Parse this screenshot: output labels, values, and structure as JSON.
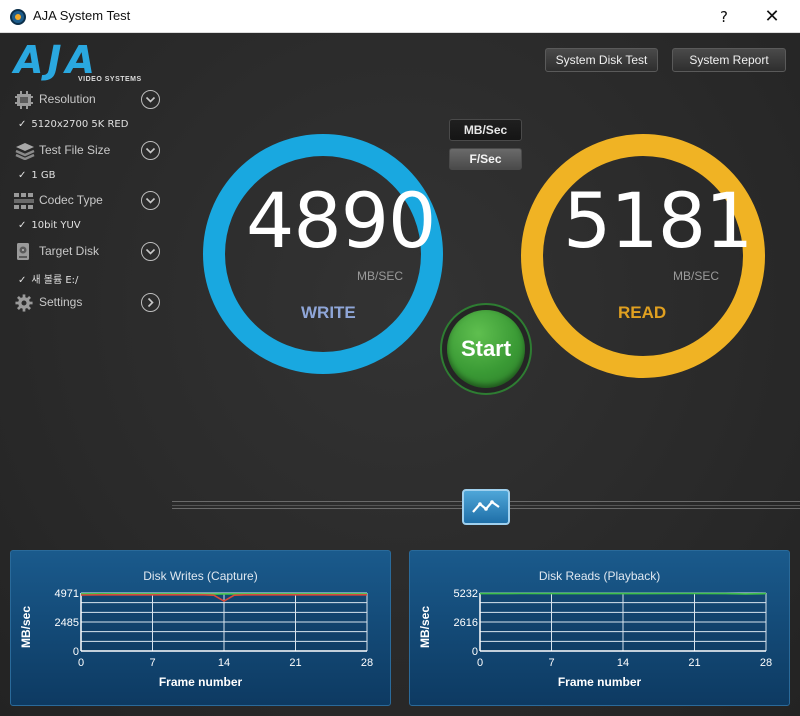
{
  "window": {
    "title": "AJA System Test",
    "help_label": "?",
    "close_label": "✕"
  },
  "logo": {
    "brand": "AJA",
    "sub": "VIDEO SYSTEMS"
  },
  "sidebar": {
    "items": [
      {
        "label": "Resolution",
        "value": "5120x2700 5K RED",
        "icon": "resolution-icon",
        "control": "expand"
      },
      {
        "label": "Test File Size",
        "value": "1 GB",
        "icon": "file-size-icon",
        "control": "expand"
      },
      {
        "label": "Codec Type",
        "value": "10bit YUV",
        "icon": "codec-icon",
        "control": "expand"
      },
      {
        "label": "Target Disk",
        "value": "새 볼륨 E:/",
        "icon": "disk-icon",
        "control": "expand"
      },
      {
        "label": "Settings",
        "icon": "gear-icon",
        "control": "arrow"
      }
    ]
  },
  "toolbar": {
    "disk_test_label": "System Disk Test",
    "report_label": "System Report"
  },
  "units": {
    "mb_label": "MB/Sec",
    "fs_label": "F/Sec",
    "selected": "F/Sec"
  },
  "write": {
    "value": "4890",
    "unit": "MB/SEC",
    "label": "WRITE",
    "color": "#19a8e0"
  },
  "read": {
    "value": "5181",
    "unit": "MB/SEC",
    "label": "READ",
    "color": "#f0b324"
  },
  "start_label": "Start",
  "chart_data": [
    {
      "type": "line",
      "title": "Disk Writes (Capture)",
      "xlabel": "Frame number",
      "ylabel": "MB/sec",
      "xlim": [
        0,
        28
      ],
      "ylim": [
        0,
        4971
      ],
      "xticks": [
        0,
        7,
        14,
        21,
        28
      ],
      "yticks": [
        0,
        2485,
        4971
      ],
      "series": [
        {
          "color": "#3ec14a",
          "x": [
            0,
            2,
            4,
            6,
            8,
            10,
            12,
            13,
            14,
            15,
            16,
            18,
            20,
            22,
            24,
            26,
            28
          ],
          "y": [
            4890,
            4900,
            4890,
            4895,
            4890,
            4890,
            4885,
            4880,
            4890,
            4890,
            4890,
            4895,
            4890,
            4890,
            4890,
            4890,
            4890
          ]
        },
        {
          "color": "#d94a3a",
          "x": [
            0,
            2,
            4,
            6,
            8,
            10,
            12,
            13,
            14,
            15,
            16,
            18,
            20,
            22,
            24,
            26,
            28
          ],
          "y": [
            4800,
            4820,
            4820,
            4820,
            4820,
            4820,
            4820,
            4780,
            4280,
            4780,
            4820,
            4820,
            4820,
            4820,
            4820,
            4820,
            4820
          ]
        }
      ]
    },
    {
      "type": "line",
      "title": "Disk Reads (Playback)",
      "xlabel": "Frame number",
      "ylabel": "MB/sec",
      "xlim": [
        0,
        28
      ],
      "ylim": [
        0,
        5232
      ],
      "xticks": [
        0,
        7,
        14,
        21,
        28
      ],
      "yticks": [
        0,
        2616,
        5232
      ],
      "series": [
        {
          "color": "#3ec14a",
          "x": [
            0,
            4,
            8,
            12,
            16,
            20,
            24,
            26,
            28
          ],
          "y": [
            5181,
            5185,
            5181,
            5180,
            5181,
            5185,
            5181,
            5150,
            5181
          ]
        }
      ]
    }
  ]
}
